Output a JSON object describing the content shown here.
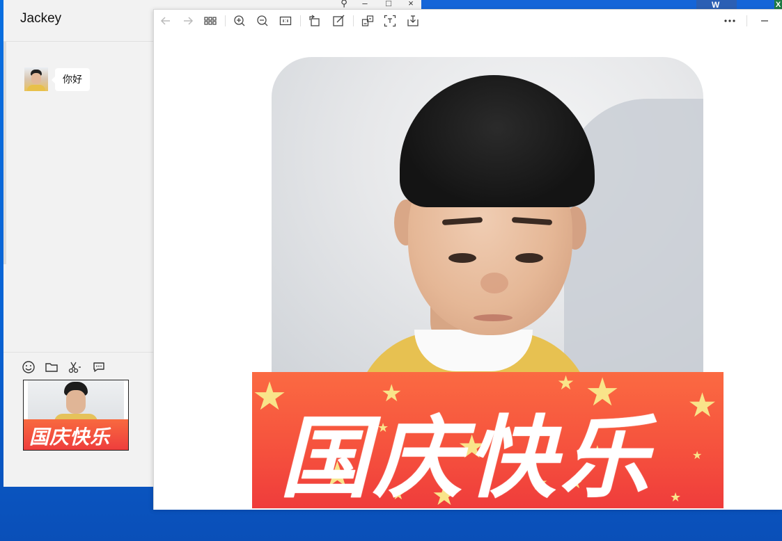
{
  "chat": {
    "contact_name": "Jackey",
    "window_controls": [
      "pin-icon",
      "minimize-icon",
      "maximize-icon",
      "close-icon"
    ],
    "messages": [
      {
        "sender": "contact",
        "text": "你好"
      }
    ],
    "input_toolbar": [
      "emoji-icon",
      "folder-icon",
      "scissors-icon",
      "chat-history-icon"
    ],
    "draft_attachment": {
      "banner_text": "国庆快乐"
    }
  },
  "viewer": {
    "toolbar_left": [
      "back-arrow-icon",
      "forward-arrow-icon",
      "grid-icon",
      "zoom-in-icon",
      "zoom-out-icon",
      "actual-size-icon",
      "rotate-icon",
      "edit-icon",
      "translate-icon",
      "extract-text-icon",
      "download-icon"
    ],
    "toolbar_right": [
      "more-icon",
      "minimize-icon"
    ],
    "image": {
      "banner_text": "国庆快乐"
    }
  },
  "taskbar": {
    "word_label": "W",
    "excel_label": "X"
  },
  "colors": {
    "banner_red": "#f5503d",
    "star_yellow": "#f9e48a",
    "desktop_blue": "#0a63d4"
  }
}
